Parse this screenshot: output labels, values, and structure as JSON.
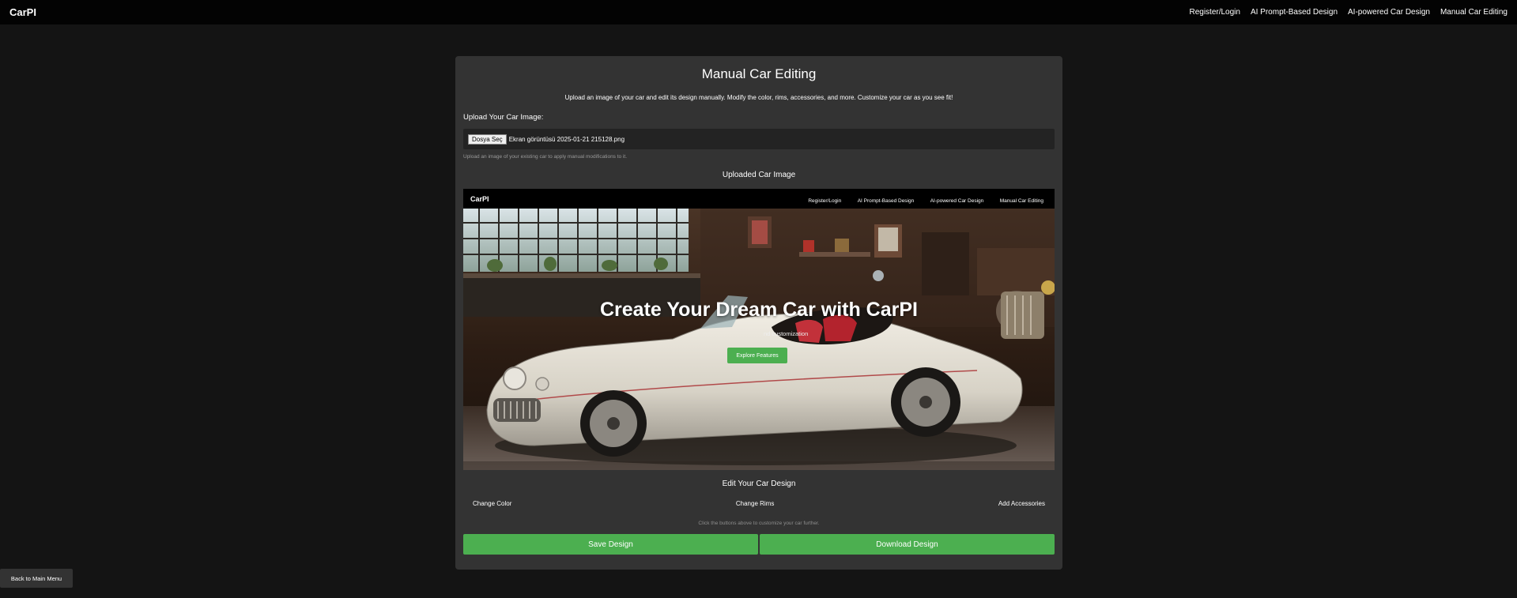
{
  "app": {
    "brand": "CarPI"
  },
  "nav": {
    "items": [
      {
        "label": "Register/Login"
      },
      {
        "label": "AI Prompt-Based Design"
      },
      {
        "label": "AI-powered Car Design"
      },
      {
        "label": "Manual Car Editing"
      }
    ]
  },
  "card": {
    "title": "Manual Car Editing",
    "description": "Upload an image of your car and edit its design manually. Modify the color, rims, accessories, and more. Customize your car as you see fit!",
    "upload_label": "Upload Your Car Image:",
    "file_button": "Dosya Seç",
    "file_name": "Ekran görüntüsü 2025-01-21 215128.png",
    "upload_hint": "Upload an image of your existing car to apply manual modifications to it.",
    "uploaded_heading": "Uploaded Car Image"
  },
  "preview": {
    "brand": "CarPI",
    "links": [
      "Register/Login",
      "AI Prompt-Based Design",
      "AI-powered Car Design",
      "Manual Car Editing"
    ],
    "hero_title": "Create Your Dream Car with CarPI",
    "hero_subtitle": "nd customization",
    "hero_button": "Explore Features"
  },
  "edit": {
    "heading": "Edit Your Car Design",
    "options": [
      "Change Color",
      "Change Rims",
      "Add Accessories"
    ],
    "hint": "Click the buttons above to customize your car further.",
    "save_label": "Save Design",
    "download_label": "Download Design"
  },
  "back_label": "Back to Main Menu",
  "colors": {
    "page_bg": "#141414",
    "topbar_bg": "#030303",
    "card_bg": "#333333",
    "accent_green": "#4caf50"
  }
}
